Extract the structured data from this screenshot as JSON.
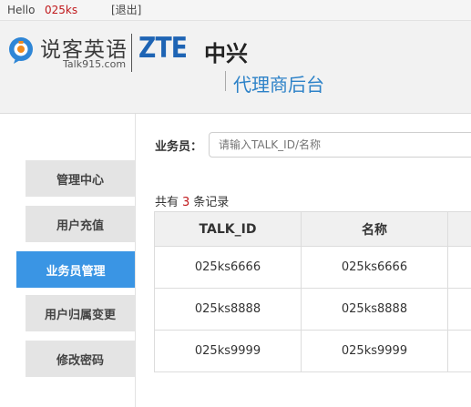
{
  "topbar": {
    "hello": "Hello",
    "username": "025ks",
    "logout": "[退出]"
  },
  "header": {
    "brand_name": "说客英语",
    "brand_url": "Talk915.com",
    "partner_logo_text": "ZTE",
    "partner_logo_cn": "中兴",
    "page_title": "代理商后台"
  },
  "sidebar": {
    "items": [
      {
        "label": "管理中心",
        "active": false
      },
      {
        "label": "用户充值",
        "active": false
      },
      {
        "label": "业务员管理",
        "active": true
      },
      {
        "label": "用户归属变更",
        "active": false
      },
      {
        "label": "修改密码",
        "active": false
      }
    ]
  },
  "search": {
    "label": "业务员：",
    "placeholder": "请输入TALK_ID/名称",
    "value": ""
  },
  "records": {
    "prefix": "共有",
    "count": "3",
    "suffix": "条记录"
  },
  "table": {
    "headers": [
      "TALK_ID",
      "名称",
      ""
    ],
    "rows": [
      [
        "025ks6666",
        "025ks6666",
        ""
      ],
      [
        "025ks8888",
        "025ks8888",
        ""
      ],
      [
        "025ks9999",
        "025ks9999",
        ""
      ]
    ]
  },
  "colors": {
    "accent": "#3a95e4",
    "highlight": "#c0191c",
    "zte_blue": "#1e64b4",
    "title_blue": "#2d82c8"
  }
}
